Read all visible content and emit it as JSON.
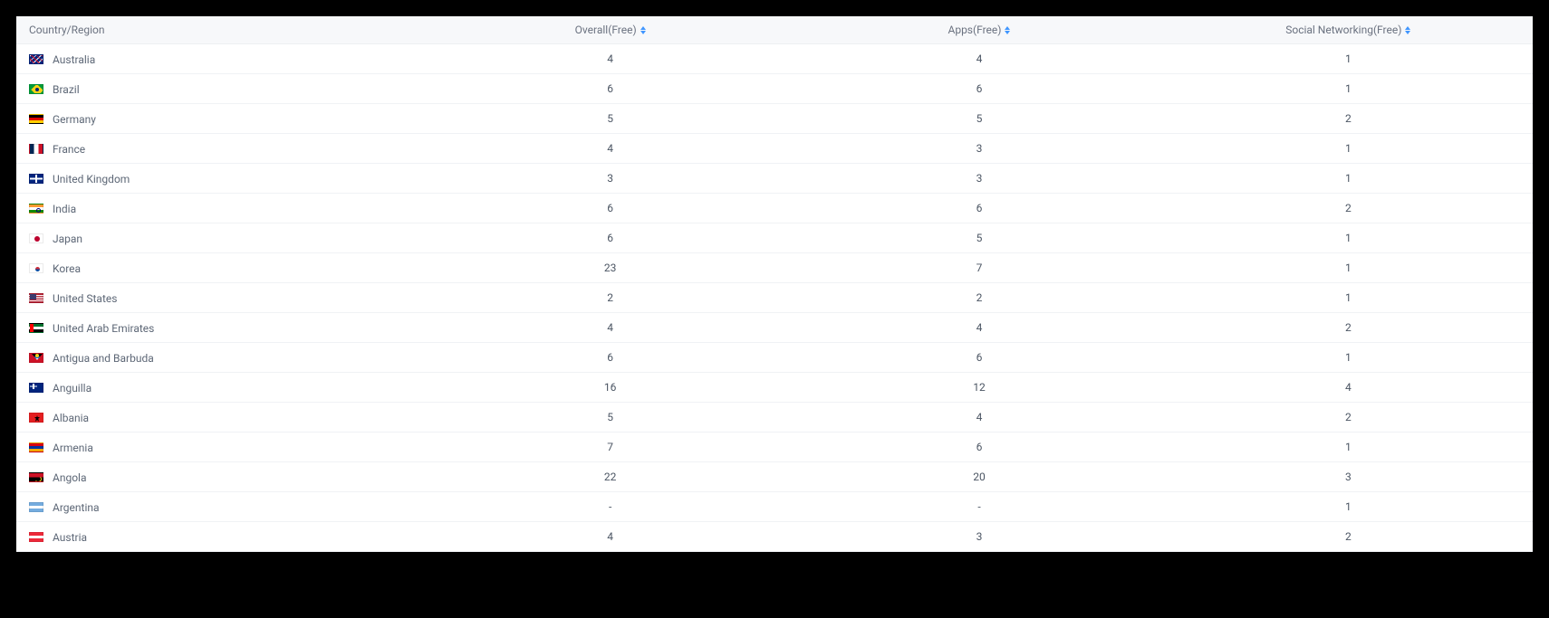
{
  "table": {
    "columns": [
      {
        "key": "country",
        "label": "Country/Region",
        "sortable": false
      },
      {
        "key": "overall",
        "label": "Overall(Free)",
        "sortable": true
      },
      {
        "key": "apps",
        "label": "Apps(Free)",
        "sortable": true
      },
      {
        "key": "social",
        "label": "Social Networking(Free)",
        "sortable": true
      }
    ],
    "rows": [
      {
        "flag": "au",
        "country": "Australia",
        "overall": "4",
        "apps": "4",
        "social": "1"
      },
      {
        "flag": "br",
        "country": "Brazil",
        "overall": "6",
        "apps": "6",
        "social": "1"
      },
      {
        "flag": "de",
        "country": "Germany",
        "overall": "5",
        "apps": "5",
        "social": "2"
      },
      {
        "flag": "fr",
        "country": "France",
        "overall": "4",
        "apps": "3",
        "social": "1"
      },
      {
        "flag": "gb",
        "country": "United Kingdom",
        "overall": "3",
        "apps": "3",
        "social": "1"
      },
      {
        "flag": "in",
        "country": "India",
        "overall": "6",
        "apps": "6",
        "social": "2"
      },
      {
        "flag": "jp",
        "country": "Japan",
        "overall": "6",
        "apps": "5",
        "social": "1"
      },
      {
        "flag": "kr",
        "country": "Korea",
        "overall": "23",
        "apps": "7",
        "social": "1"
      },
      {
        "flag": "us",
        "country": "United States",
        "overall": "2",
        "apps": "2",
        "social": "1"
      },
      {
        "flag": "ae",
        "country": "United Arab Emirates",
        "overall": "4",
        "apps": "4",
        "social": "2"
      },
      {
        "flag": "ag",
        "country": "Antigua and Barbuda",
        "overall": "6",
        "apps": "6",
        "social": "1"
      },
      {
        "flag": "ai",
        "country": "Anguilla",
        "overall": "16",
        "apps": "12",
        "social": "4"
      },
      {
        "flag": "al",
        "country": "Albania",
        "overall": "5",
        "apps": "4",
        "social": "2"
      },
      {
        "flag": "am",
        "country": "Armenia",
        "overall": "7",
        "apps": "6",
        "social": "1"
      },
      {
        "flag": "ao",
        "country": "Angola",
        "overall": "22",
        "apps": "20",
        "social": "3"
      },
      {
        "flag": "ar",
        "country": "Argentina",
        "overall": "-",
        "apps": "-",
        "social": "1"
      },
      {
        "flag": "at",
        "country": "Austria",
        "overall": "4",
        "apps": "3",
        "social": "2"
      }
    ]
  }
}
